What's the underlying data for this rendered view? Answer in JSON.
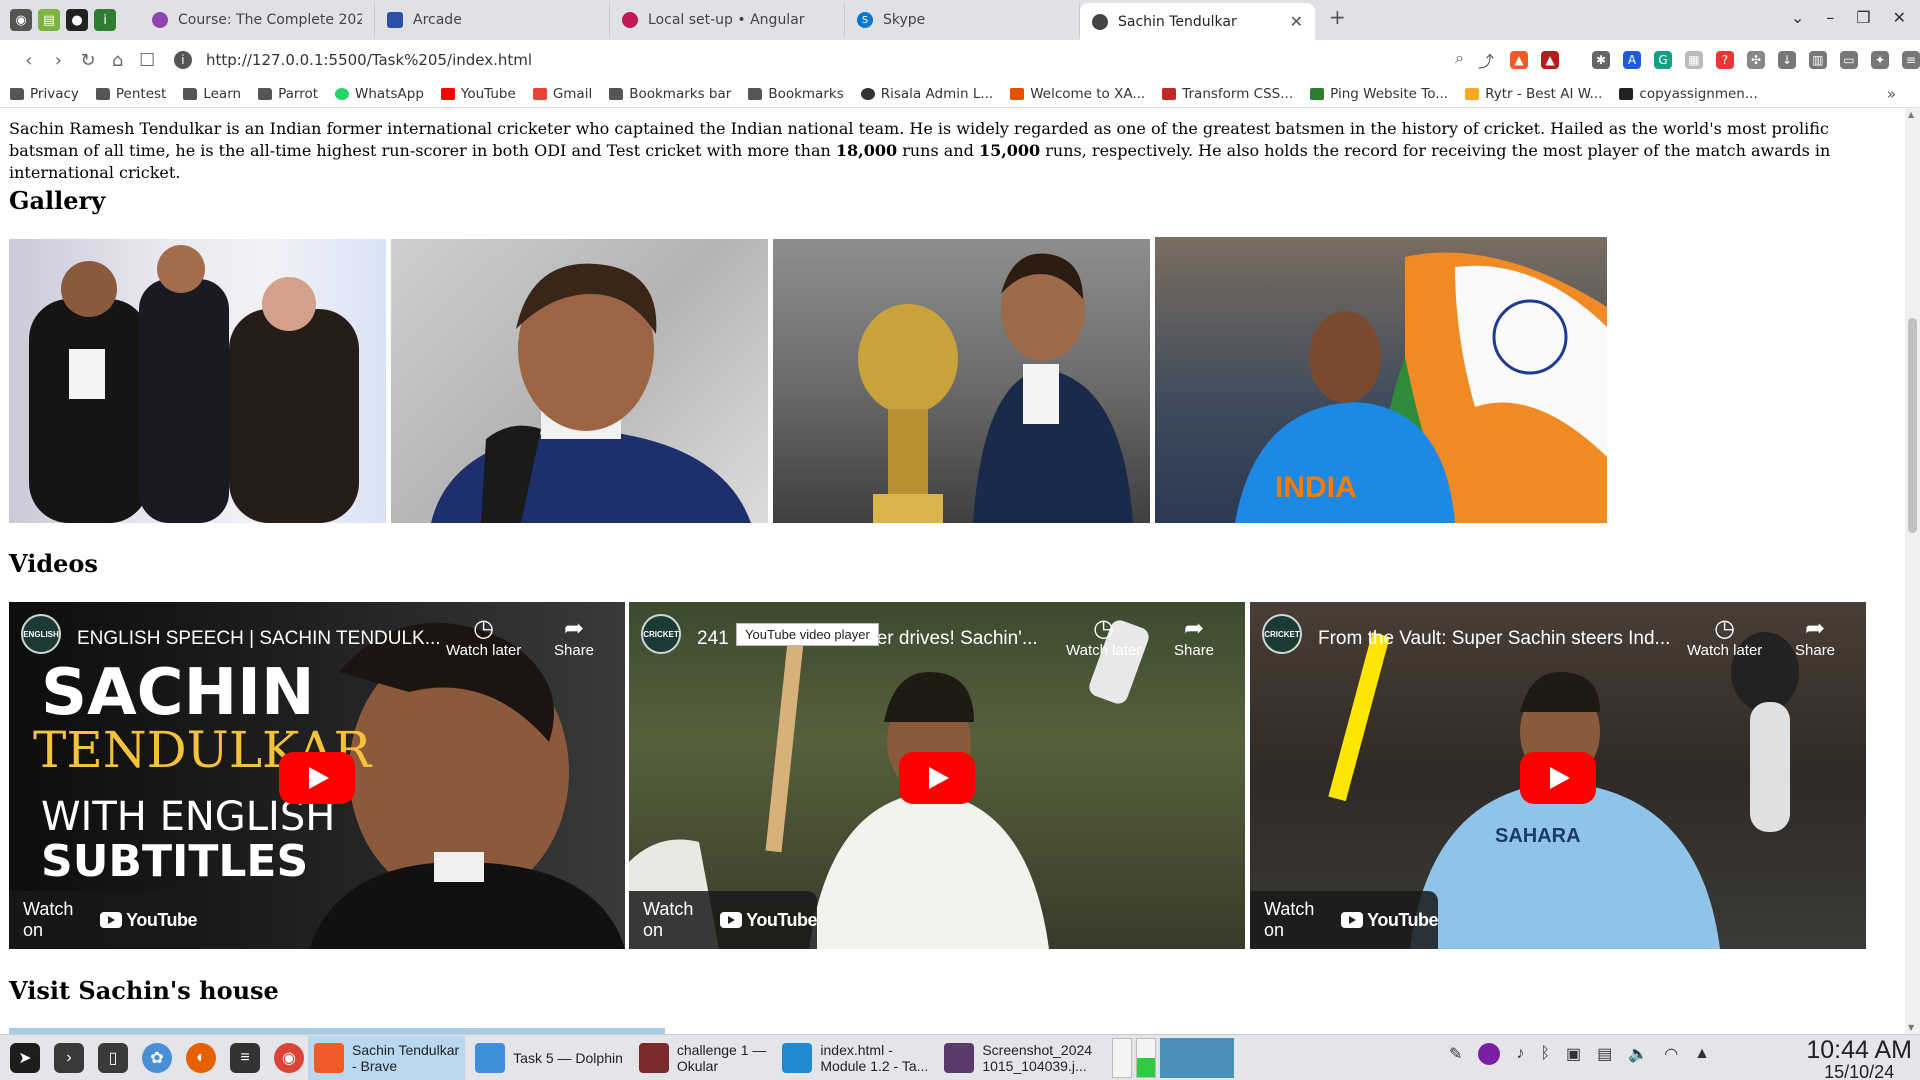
{
  "browser": {
    "tabs": [
      {
        "label": "Course: The Complete 2024",
        "color": "#8e44ad"
      },
      {
        "label": "Arcade",
        "color": "#2f4fa8"
      },
      {
        "label": "Local set-up • Angular",
        "color": "#c2185b"
      },
      {
        "label": "Skype",
        "color": "#0078d4"
      },
      {
        "label": "Sachin Tendulkar",
        "color": "#444444"
      }
    ],
    "url": "http://127.0.0.1:5500/Task%205/index.html",
    "bookmarks": [
      "Privacy",
      "Pentest",
      "Learn",
      "Parrot",
      "WhatsApp",
      "YouTube",
      "Gmail",
      "Bookmarks bar",
      "Bookmarks",
      "Risala Admin L...",
      "Welcome to XA...",
      "Transform CSS...",
      "Ping Website To...",
      "Rytr - Best AI W...",
      "copyassignmen..."
    ]
  },
  "page": {
    "intro_before": "Sachin Ramesh Tendulkar is an Indian former international cricketer who captained the Indian national team. He is widely regarded as one of the greatest batsmen in the history of cricket. Hailed as the world's most prolific batsman of all time, he is the all-time highest run-scorer in both ODI and Test cricket with more than ",
    "intro_bold1": "18,000",
    "intro_mid": " runs and ",
    "intro_bold2": "15,000",
    "intro_after": " runs, respectively. He also holds the record for receiving the most player of the match awards in international cricket.",
    "gallery_heading": "Gallery",
    "videos_heading": "Videos",
    "visit_heading": "Visit Sachin's house",
    "videos": [
      {
        "title": "ENGLISH SPEECH | SACHIN TENDULK...",
        "channel_logo": "ENGLISH"
      },
      {
        "title": "241",
        "title_rest": "er drives! Sachin'...",
        "channel_logo": "CRICKET"
      },
      {
        "title": "From the Vault: Super Sachin steers Ind...",
        "channel_logo": "CRICKET"
      }
    ],
    "video1_overlay": [
      "SACHIN",
      "TENDULKAR",
      "WITH ENGLISH",
      "SUBTITLES"
    ],
    "watch_later": "Watch later",
    "share": "Share",
    "watch_on": "Watch on",
    "youtube": "YouTube",
    "tooltip": "YouTube video player"
  },
  "taskbar": {
    "tasks": [
      {
        "label1": "Sachin Tendulkar",
        "label2": "- Brave"
      },
      {
        "label1": "Task 5 — Dolphin",
        "label2": ""
      },
      {
        "label1": "challenge 1 —",
        "label2": "Okular"
      },
      {
        "label1": "index.html -",
        "label2": "Module 1.2 - Ta..."
      },
      {
        "label1": "Screenshot_2024",
        "label2": "1015_104039.j..."
      }
    ],
    "time": "10:44 AM",
    "date": "15/10/24"
  }
}
